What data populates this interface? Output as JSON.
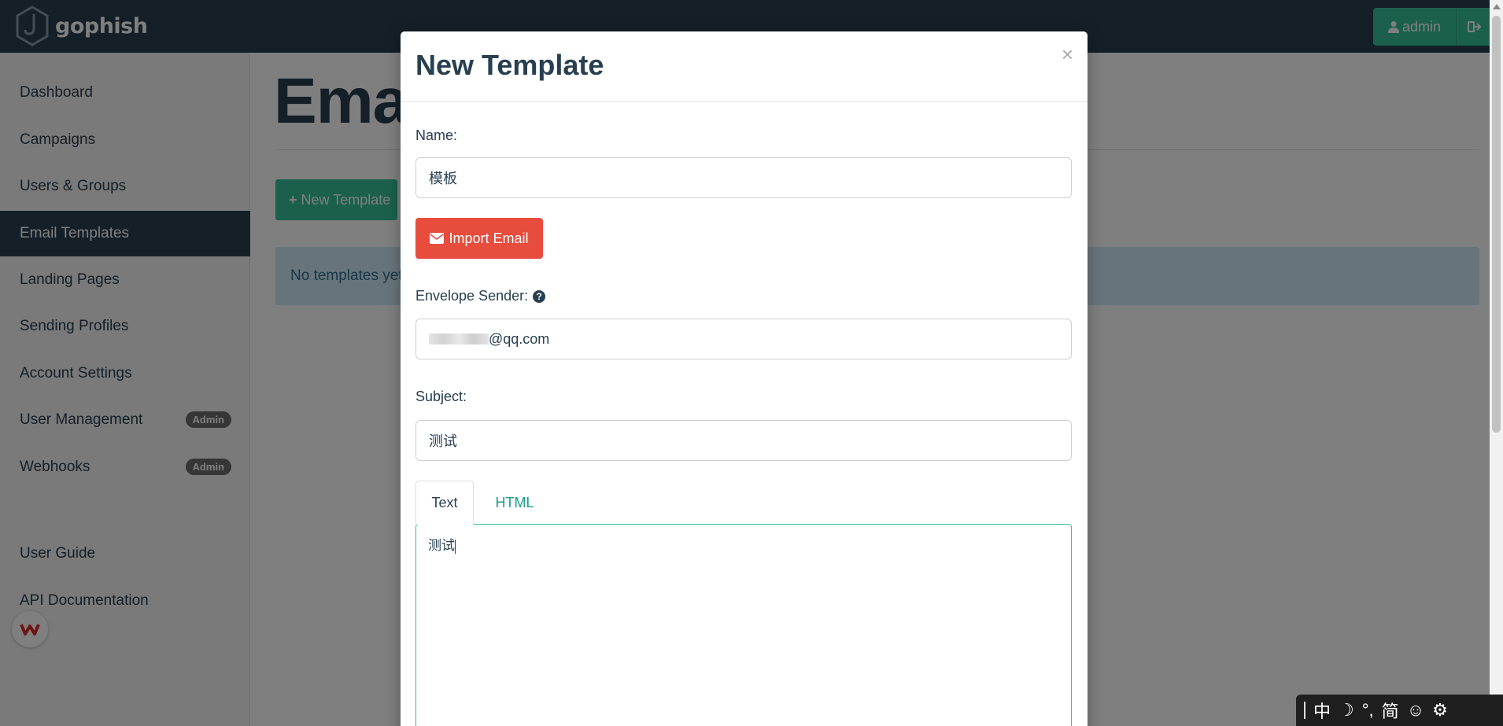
{
  "navbar": {
    "brand": "gophish",
    "user_label": "admin"
  },
  "sidebar": {
    "items": [
      {
        "label": "Dashboard"
      },
      {
        "label": "Campaigns"
      },
      {
        "label": "Users & Groups"
      },
      {
        "label": "Email Templates",
        "active": true
      },
      {
        "label": "Landing Pages"
      },
      {
        "label": "Sending Profiles"
      },
      {
        "label": "Account Settings"
      },
      {
        "label": "User Management",
        "badge": "Admin"
      },
      {
        "label": "Webhooks",
        "badge": "Admin"
      },
      {
        "label": "User Guide"
      },
      {
        "label": "API Documentation"
      }
    ]
  },
  "main": {
    "title": "Emai",
    "new_button_label": "New Template",
    "empty_message": "No templates yet"
  },
  "modal": {
    "title": "New Template",
    "close_symbol": "×",
    "name_label": "Name:",
    "name_value": "模板",
    "import_button": "Import Email",
    "envelope_label": "Envelope Sender:",
    "envelope_value_suffix": "@qq.com",
    "subject_label": "Subject:",
    "subject_value": "测试",
    "tabs": [
      {
        "label": "Text",
        "active": true
      },
      {
        "label": "HTML",
        "active": false
      }
    ],
    "body_text": "测试"
  },
  "ime": {
    "items": [
      "中",
      "☽",
      "°,",
      "简",
      "☺",
      "⚙"
    ]
  },
  "colors": {
    "navbar": "#283f50",
    "accent": "#37c09b",
    "danger": "#e74c3c",
    "info_bg": "#d1e9f6"
  }
}
